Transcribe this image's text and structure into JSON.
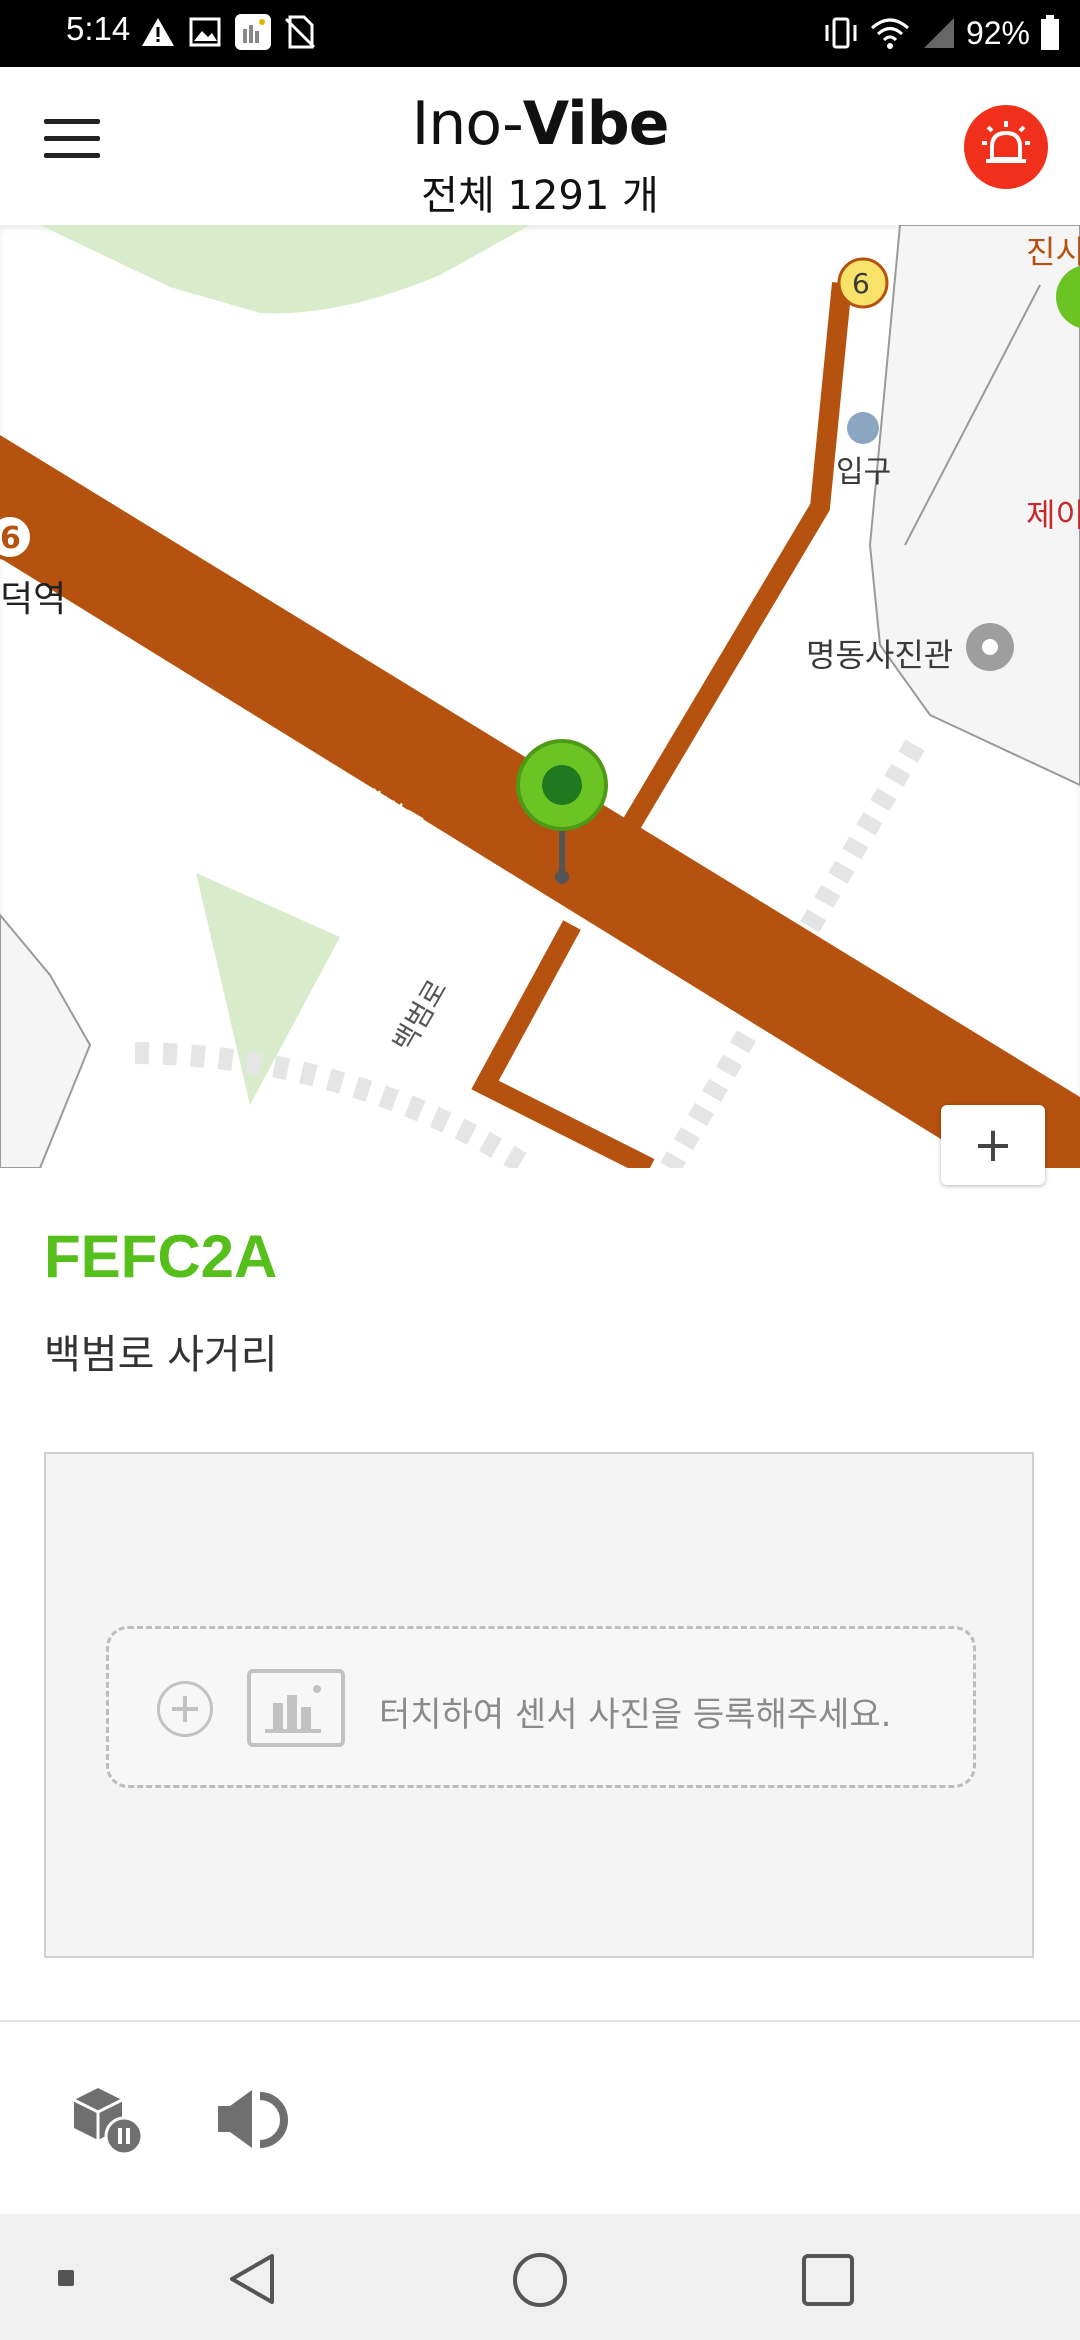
{
  "status_bar": {
    "time": "5:14",
    "battery": "92%",
    "left_icons": [
      "warning-icon",
      "image-icon",
      "app-notification-icon",
      "no-sim-icon"
    ],
    "right_icons": [
      "vibrate-icon",
      "wifi-icon",
      "signal-icon",
      "battery-icon"
    ]
  },
  "header": {
    "brand_part1": "Ino-",
    "brand_part2": "Vibe",
    "total_label": "전체 1291 개",
    "menu_icon": "hamburger-menu-icon",
    "alarm_icon": "alarm-bell-icon",
    "alarm_color": "#f0301b"
  },
  "map": {
    "labels": {
      "station": "덕역",
      "station_badge": "6",
      "badge_top": "6",
      "entrance": "입구",
      "photo_studio": "명동사진관",
      "road1": "백범로",
      "road2": "백범로",
      "road3": "백범로",
      "top_right": "진시",
      "right_red": "제이"
    },
    "road_color": "#b5520f",
    "marker_color": "#56bf1b",
    "zoom_in": "+"
  },
  "sensor": {
    "id": "FEFC2A",
    "address": "백범로 사거리",
    "id_color": "#56bf1b"
  },
  "photo": {
    "upload_text": "터치하여 센서 사진을 등록해주세요."
  },
  "actions": {
    "pause_device_icon": "device-pause-icon",
    "speaker_icon": "speaker-icon"
  },
  "nav": {
    "items": [
      "recent-apps-dot-icon",
      "back-icon",
      "home-icon",
      "overview-icon"
    ]
  }
}
